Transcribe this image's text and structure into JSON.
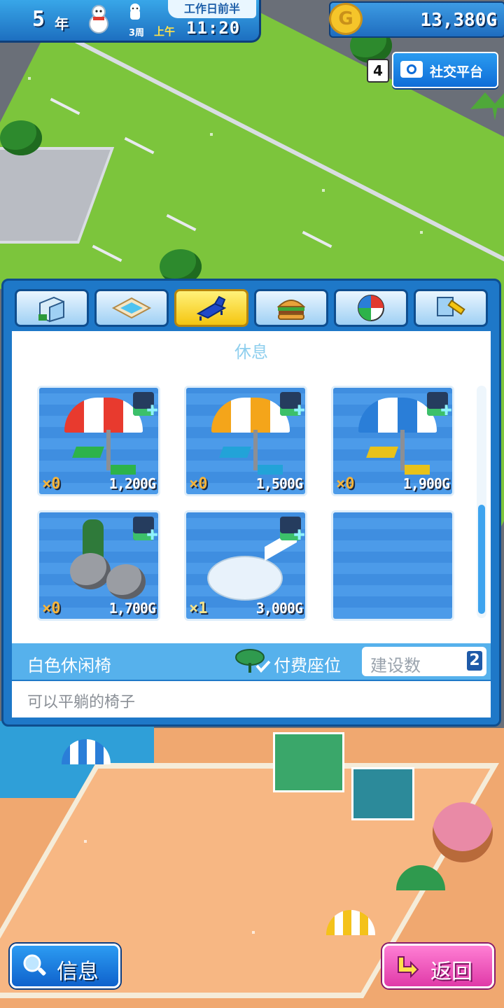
{
  "hud": {
    "year": "5",
    "year_unit": "年",
    "week": "3周",
    "ampm": "上午",
    "time": "11:20",
    "period": "工作日前半",
    "money": "13,380G",
    "coin_symbol": "G",
    "notification_count": "4",
    "social_label": "社交平台"
  },
  "panel": {
    "category_title": "休息",
    "tabs": [
      {
        "icon": "building-icon",
        "active": false
      },
      {
        "icon": "pool-icon",
        "active": false
      },
      {
        "icon": "lounge-chair-icon",
        "active": true
      },
      {
        "icon": "hamburger-icon",
        "active": false
      },
      {
        "icon": "beach-ball-icon",
        "active": false
      },
      {
        "icon": "hammer-icon",
        "active": false
      }
    ],
    "items": [
      {
        "qty": "×0",
        "price": "1,200G",
        "umbrella_color": "#e83a2e",
        "chair_color": "#2db34a"
      },
      {
        "qty": "×0",
        "price": "1,500G",
        "umbrella_color": "#f4a51a",
        "chair_color": "#22a3d8"
      },
      {
        "qty": "×0",
        "price": "1,900G",
        "umbrella_color": "#2a7ed8",
        "chair_color": "#e8c21a"
      },
      {
        "qty": "×0",
        "price": "1,700G",
        "icon": "rocks-icon"
      },
      {
        "qty": "×1",
        "price": "3,000G",
        "icon": "white-lounge-chair-icon"
      },
      {
        "empty": true
      }
    ],
    "selected": {
      "name": "白色休闲椅",
      "attribute": "付费座位",
      "build_label": "建设数",
      "build_count": "2",
      "description": "可以平躺的椅子"
    }
  },
  "buttons": {
    "info_label": "信息",
    "back_label": "返回"
  },
  "colors": {
    "panel": "#1e78c8",
    "active_tab": "#f5c510",
    "info_button": "#0f62cc",
    "back_button": "#e03aa8",
    "qty_text": "#f6b43a"
  }
}
